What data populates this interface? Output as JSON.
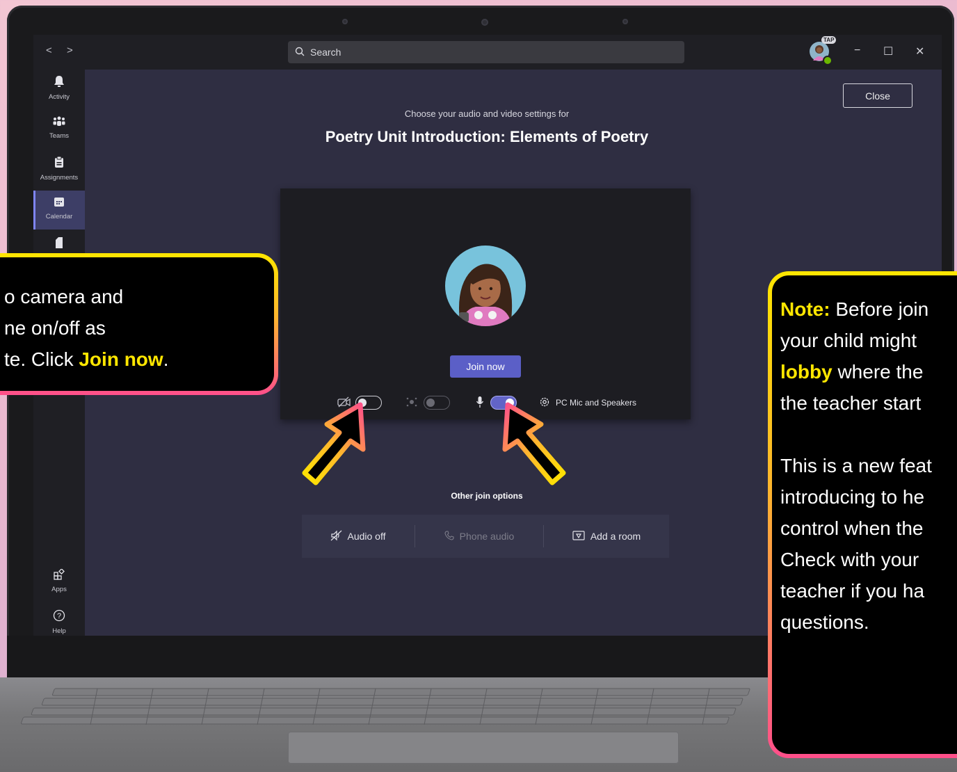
{
  "window": {
    "search_placeholder": "Search",
    "badge": "TAP",
    "minimize_glyph": "−",
    "maximize_glyph": "☐",
    "close_glyph": "✕",
    "nav_back": "<",
    "nav_forward": ">"
  },
  "rail": {
    "items": [
      {
        "label": "Activity",
        "icon": "bell-icon"
      },
      {
        "label": "Teams",
        "icon": "teams-icon"
      },
      {
        "label": "Assignments",
        "icon": "assignments-icon"
      },
      {
        "label": "Calendar",
        "icon": "calendar-icon",
        "active": true
      },
      {
        "label": "Apps",
        "icon": "apps-icon"
      },
      {
        "label": "Help",
        "icon": "help-icon"
      }
    ]
  },
  "meeting": {
    "close_label": "Close",
    "subtitle": "Choose your audio and video settings for",
    "title": "Poetry Unit Introduction: Elements of Poetry",
    "join_label": "Join now",
    "camera_on": false,
    "background_blur_on": false,
    "mic_on": true,
    "device_label": "PC Mic and Speakers",
    "other_join_label": "Other join options",
    "options": [
      "Audio off",
      "Phone audio",
      "Add a room"
    ]
  },
  "callout_left": {
    "lines": [
      "o camera and",
      "ne on/off as",
      "te. Click "
    ],
    "highlight": "Join now",
    "after": "."
  },
  "callout_right": {
    "note_label": "Note:",
    "line1": " Before join",
    "line2": "your child might",
    "lobby": "lobby",
    "line3": " where the",
    "line4": "the teacher start",
    "line5": "This is a new feat",
    "line6": "introducing to he",
    "line7": "control when the",
    "line8": "Check with your",
    "line9": "teacher if you ha",
    "line10": "questions."
  },
  "colors": {
    "accent": "#5b5fc7",
    "status_available": "#6bb700",
    "callout_gradient_top": "#ffe600",
    "callout_gradient_bottom": "#ff4f8b"
  }
}
